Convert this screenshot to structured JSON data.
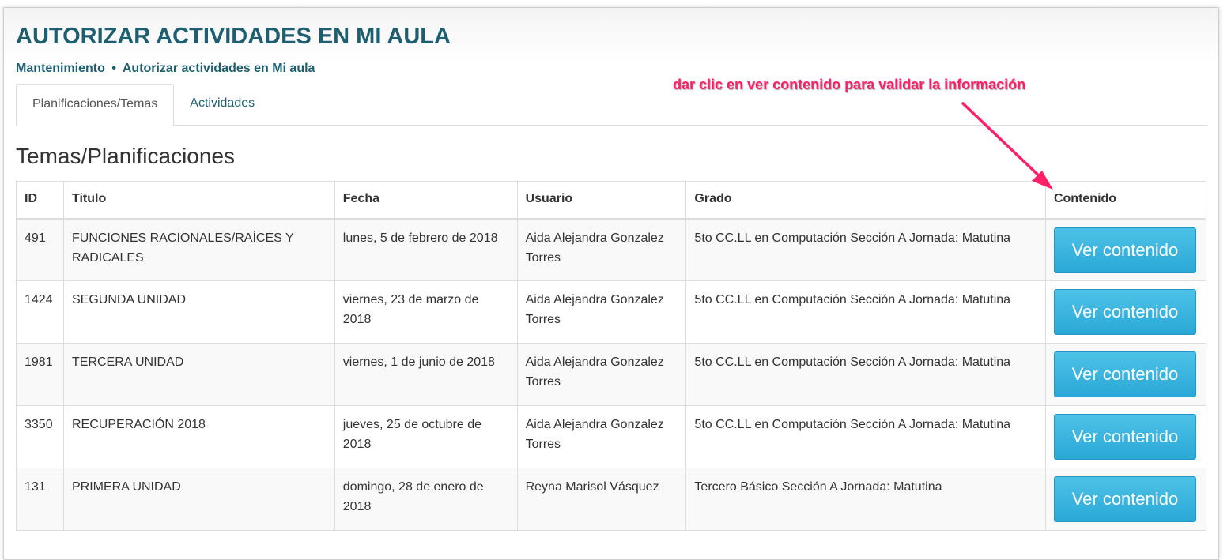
{
  "header": {
    "title": "AUTORIZAR ACTIVIDADES EN MI AULA",
    "breadcrumb": {
      "link": "Mantenimiento",
      "separator": "•",
      "current": "Autorizar actividades en Mi aula"
    }
  },
  "tabs": [
    {
      "label": "Planificaciones/Temas",
      "active": true
    },
    {
      "label": "Actividades",
      "active": false
    }
  ],
  "section_title": "Temas/Planificaciones",
  "table": {
    "columns": [
      "ID",
      "Titulo",
      "Fecha",
      "Usuario",
      "Grado",
      "Contenido"
    ],
    "rows": [
      {
        "id": "491",
        "titulo": "FUNCIONES RACIONALES/RAÍCES Y RADICALES",
        "fecha": "lunes, 5 de febrero de 2018",
        "usuario": "Aida Alejandra Gonzalez Torres",
        "grado": "5to CC.LL en Computación Sección A Jornada: Matutina",
        "button": "Ver contenido"
      },
      {
        "id": "1424",
        "titulo": "SEGUNDA UNIDAD",
        "fecha": "viernes, 23 de marzo de 2018",
        "usuario": "Aida Alejandra Gonzalez Torres",
        "grado": "5to CC.LL en Computación Sección A Jornada: Matutina",
        "button": "Ver contenido"
      },
      {
        "id": "1981",
        "titulo": "TERCERA UNIDAD",
        "fecha": "viernes, 1 de junio de 2018",
        "usuario": "Aida Alejandra Gonzalez Torres",
        "grado": "5to CC.LL en Computación Sección A Jornada: Matutina",
        "button": "Ver contenido"
      },
      {
        "id": "3350",
        "titulo": "RECUPERACIÓN 2018",
        "fecha": "jueves, 25 de octubre de 2018",
        "usuario": "Aida Alejandra Gonzalez Torres",
        "grado": "5to CC.LL en Computación Sección A Jornada: Matutina",
        "button": "Ver contenido"
      },
      {
        "id": "131",
        "titulo": "PRIMERA UNIDAD",
        "fecha": "domingo, 28 de enero de 2018",
        "usuario": "Reyna Marisol Vásquez",
        "grado": "Tercero Básico Sección A Jornada: Matutina",
        "button": "Ver contenido"
      }
    ]
  },
  "annotation": {
    "text": "dar clic en ver contenido para validar la información",
    "color": "#ff2068"
  },
  "colors": {
    "title": "#1f5e6e",
    "button": "#2aa8d6"
  }
}
